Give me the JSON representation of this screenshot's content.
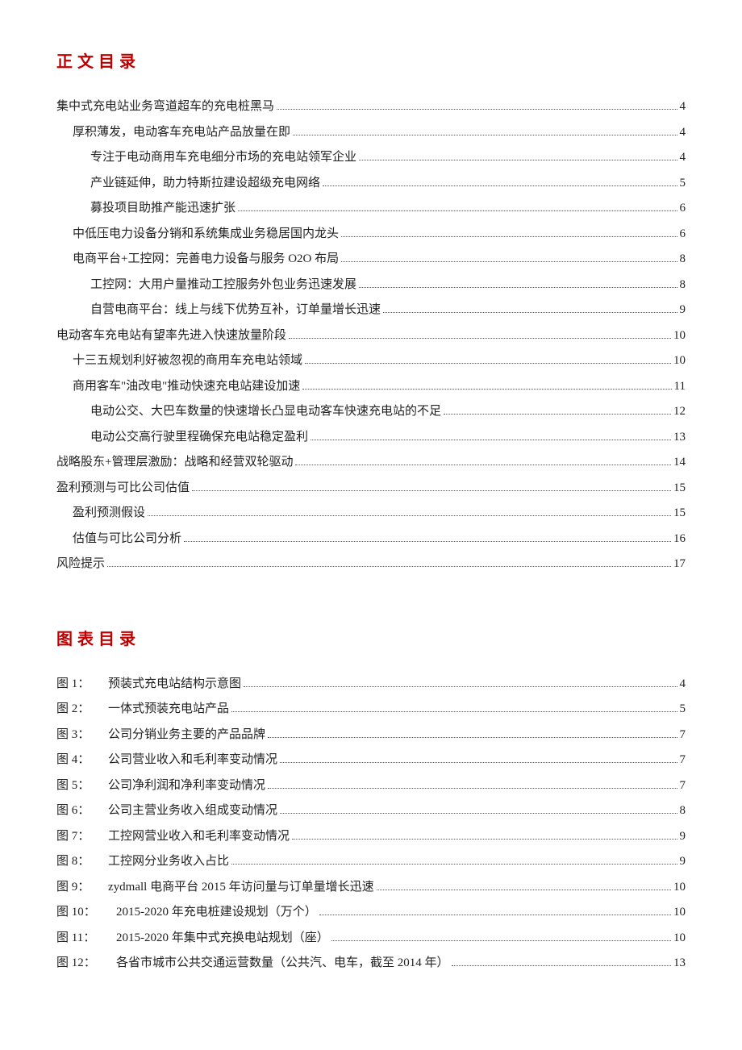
{
  "toc_title": "正文目录",
  "fig_title": "图表目录",
  "toc": [
    {
      "level": 1,
      "label": "集中式充电站业务弯道超车的充电桩黑马",
      "page": "4"
    },
    {
      "level": 2,
      "label": "厚积薄发，电动客车充电站产品放量在即",
      "page": "4"
    },
    {
      "level": 3,
      "label": "专注于电动商用车充电细分市场的充电站领军企业",
      "page": "4"
    },
    {
      "level": 3,
      "label": "产业链延伸，助力特斯拉建设超级充电网络",
      "page": "5"
    },
    {
      "level": 3,
      "label": "募投项目助推产能迅速扩张",
      "page": "6"
    },
    {
      "level": 2,
      "label": "中低压电力设备分销和系统集成业务稳居国内龙头",
      "page": "6"
    },
    {
      "level": 2,
      "label": "电商平台+工控网：完善电力设备与服务 O2O 布局",
      "page": "8"
    },
    {
      "level": 3,
      "label": "工控网：大用户量推动工控服务外包业务迅速发展",
      "page": "8"
    },
    {
      "level": 3,
      "label": "自营电商平台：线上与线下优势互补，订单量增长迅速",
      "page": "9"
    },
    {
      "level": 1,
      "label": "电动客车充电站有望率先进入快速放量阶段",
      "page": "10"
    },
    {
      "level": 2,
      "label": "十三五规划利好被忽视的商用车充电站领域",
      "page": "10"
    },
    {
      "level": 2,
      "label": "商用客车\"油改电\"推动快速充电站建设加速",
      "page": "11"
    },
    {
      "level": 3,
      "label": "电动公交、大巴车数量的快速增长凸显电动客车快速充电站的不足",
      "page": "12"
    },
    {
      "level": 3,
      "label": "电动公交高行驶里程确保充电站稳定盈利",
      "page": "13"
    },
    {
      "level": 1,
      "label": "战略股东+管理层激励：战略和经营双轮驱动",
      "page": "14"
    },
    {
      "level": 1,
      "label": "盈利预测与可比公司估值",
      "page": "15"
    },
    {
      "level": 2,
      "label": "盈利预测假设",
      "page": "15"
    },
    {
      "level": 2,
      "label": "估值与可比公司分析",
      "page": "16"
    },
    {
      "level": 1,
      "label": "风险提示",
      "page": "17"
    }
  ],
  "figures": [
    {
      "prefix": "图 1：",
      "label": "预装式充电站结构示意图",
      "page": "4"
    },
    {
      "prefix": "图 2：",
      "label": "一体式预装充电站产品",
      "page": "5"
    },
    {
      "prefix": "图 3：",
      "label": "公司分销业务主要的产品品牌",
      "page": "7"
    },
    {
      "prefix": "图 4：",
      "label": "公司营业收入和毛利率变动情况",
      "page": "7"
    },
    {
      "prefix": "图 5：",
      "label": "公司净利润和净利率变动情况",
      "page": "7"
    },
    {
      "prefix": "图 6：",
      "label": "公司主营业务收入组成变动情况",
      "page": "8"
    },
    {
      "prefix": "图 7：",
      "label": "工控网营业收入和毛利率变动情况",
      "page": "9"
    },
    {
      "prefix": "图 8：",
      "label": "工控网分业务收入占比",
      "page": "9"
    },
    {
      "prefix": "图 9：",
      "label": "zydmall 电商平台 2015 年访问量与订单量增长迅速",
      "page": "10"
    },
    {
      "prefix": "图 10：",
      "label": "2015-2020 年充电桩建设规划（万个）",
      "page": "10",
      "wide": true
    },
    {
      "prefix": "图 11：",
      "label": "2015-2020 年集中式充换电站规划（座）",
      "page": "10",
      "wide": true
    },
    {
      "prefix": "图 12：",
      "label": "各省市城市公共交通运营数量（公共汽、电车，截至 2014 年）",
      "page": "13",
      "wide": true
    }
  ]
}
